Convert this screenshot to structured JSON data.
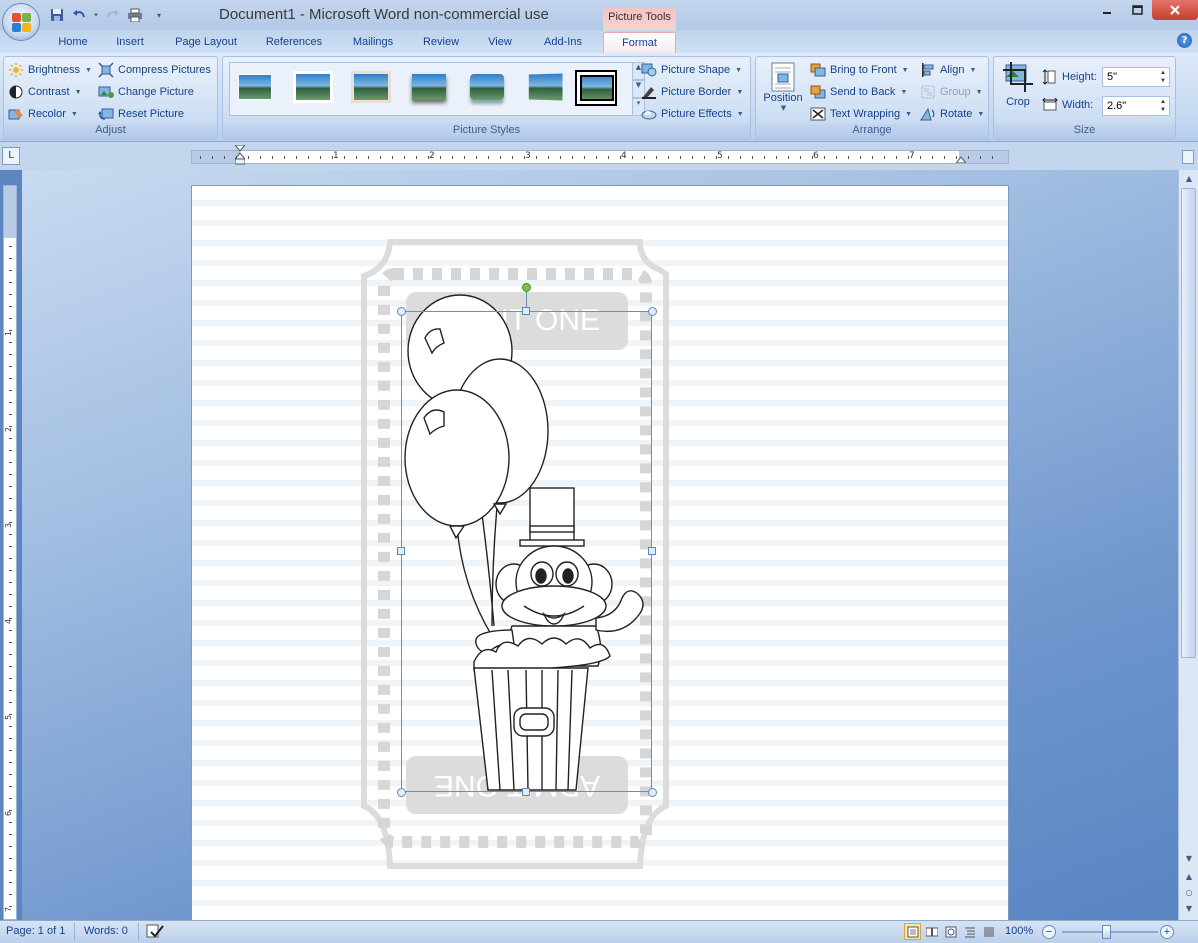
{
  "window": {
    "title": "Document1 - Microsoft Word non-commercial use",
    "contextual_tab_group": "Picture Tools"
  },
  "tabs": [
    "Home",
    "Insert",
    "Page Layout",
    "References",
    "Mailings",
    "Review",
    "View",
    "Add-Ins",
    "Format"
  ],
  "active_tab": "Format",
  "ribbon": {
    "adjust": {
      "label": "Adjust",
      "brightness": "Brightness",
      "contrast": "Contrast",
      "recolor": "Recolor",
      "compress": "Compress Pictures",
      "change": "Change Picture",
      "reset": "Reset Picture"
    },
    "picture_styles": {
      "label": "Picture Styles",
      "shape": "Picture Shape",
      "border": "Picture Border",
      "effects": "Picture Effects"
    },
    "arrange": {
      "label": "Arrange",
      "position": "Position",
      "bring_front": "Bring to Front",
      "send_back": "Send to Back",
      "text_wrapping": "Text Wrapping",
      "align": "Align",
      "group": "Group",
      "rotate": "Rotate"
    },
    "size": {
      "label": "Size",
      "crop": "Crop",
      "height_label": "Height:",
      "height_value": "5\"",
      "width_label": "Width:",
      "width_value": "2.6\""
    }
  },
  "ruler": {
    "numbers": [
      "1",
      "2",
      "3",
      "4",
      "5",
      "6",
      "7"
    ],
    "vnumbers": [
      "1",
      "2",
      "3",
      "4",
      "5",
      "6",
      "7"
    ]
  },
  "document": {
    "ticket_text_top": "ADMIT ONE",
    "ticket_text_bottom": "ADMIT ONE"
  },
  "status": {
    "page": "Page: 1 of 1",
    "words": "Words: 0",
    "zoom": "100%"
  },
  "colors": {
    "ribbon_text": "#15428b",
    "contextual_tab": "#f2c4c2",
    "selection_handle": "#7fb0e0",
    "rotate_handle": "#7cc144"
  }
}
